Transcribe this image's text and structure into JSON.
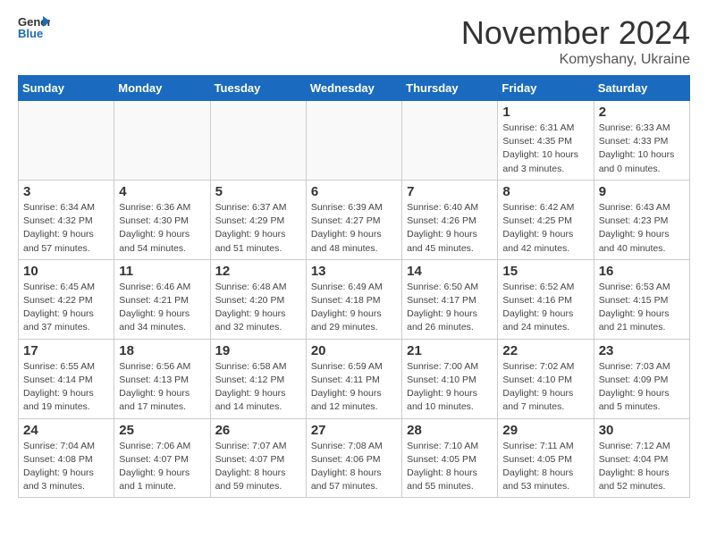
{
  "header": {
    "logo_general": "General",
    "logo_blue": "Blue",
    "month_title": "November 2024",
    "location": "Komyshany, Ukraine"
  },
  "weekdays": [
    "Sunday",
    "Monday",
    "Tuesday",
    "Wednesday",
    "Thursday",
    "Friday",
    "Saturday"
  ],
  "weeks": [
    [
      {
        "day": "",
        "info": ""
      },
      {
        "day": "",
        "info": ""
      },
      {
        "day": "",
        "info": ""
      },
      {
        "day": "",
        "info": ""
      },
      {
        "day": "",
        "info": ""
      },
      {
        "day": "1",
        "info": "Sunrise: 6:31 AM\nSunset: 4:35 PM\nDaylight: 10 hours\nand 3 minutes."
      },
      {
        "day": "2",
        "info": "Sunrise: 6:33 AM\nSunset: 4:33 PM\nDaylight: 10 hours\nand 0 minutes."
      }
    ],
    [
      {
        "day": "3",
        "info": "Sunrise: 6:34 AM\nSunset: 4:32 PM\nDaylight: 9 hours\nand 57 minutes."
      },
      {
        "day": "4",
        "info": "Sunrise: 6:36 AM\nSunset: 4:30 PM\nDaylight: 9 hours\nand 54 minutes."
      },
      {
        "day": "5",
        "info": "Sunrise: 6:37 AM\nSunset: 4:29 PM\nDaylight: 9 hours\nand 51 minutes."
      },
      {
        "day": "6",
        "info": "Sunrise: 6:39 AM\nSunset: 4:27 PM\nDaylight: 9 hours\nand 48 minutes."
      },
      {
        "day": "7",
        "info": "Sunrise: 6:40 AM\nSunset: 4:26 PM\nDaylight: 9 hours\nand 45 minutes."
      },
      {
        "day": "8",
        "info": "Sunrise: 6:42 AM\nSunset: 4:25 PM\nDaylight: 9 hours\nand 42 minutes."
      },
      {
        "day": "9",
        "info": "Sunrise: 6:43 AM\nSunset: 4:23 PM\nDaylight: 9 hours\nand 40 minutes."
      }
    ],
    [
      {
        "day": "10",
        "info": "Sunrise: 6:45 AM\nSunset: 4:22 PM\nDaylight: 9 hours\nand 37 minutes."
      },
      {
        "day": "11",
        "info": "Sunrise: 6:46 AM\nSunset: 4:21 PM\nDaylight: 9 hours\nand 34 minutes."
      },
      {
        "day": "12",
        "info": "Sunrise: 6:48 AM\nSunset: 4:20 PM\nDaylight: 9 hours\nand 32 minutes."
      },
      {
        "day": "13",
        "info": "Sunrise: 6:49 AM\nSunset: 4:18 PM\nDaylight: 9 hours\nand 29 minutes."
      },
      {
        "day": "14",
        "info": "Sunrise: 6:50 AM\nSunset: 4:17 PM\nDaylight: 9 hours\nand 26 minutes."
      },
      {
        "day": "15",
        "info": "Sunrise: 6:52 AM\nSunset: 4:16 PM\nDaylight: 9 hours\nand 24 minutes."
      },
      {
        "day": "16",
        "info": "Sunrise: 6:53 AM\nSunset: 4:15 PM\nDaylight: 9 hours\nand 21 minutes."
      }
    ],
    [
      {
        "day": "17",
        "info": "Sunrise: 6:55 AM\nSunset: 4:14 PM\nDaylight: 9 hours\nand 19 minutes."
      },
      {
        "day": "18",
        "info": "Sunrise: 6:56 AM\nSunset: 4:13 PM\nDaylight: 9 hours\nand 17 minutes."
      },
      {
        "day": "19",
        "info": "Sunrise: 6:58 AM\nSunset: 4:12 PM\nDaylight: 9 hours\nand 14 minutes."
      },
      {
        "day": "20",
        "info": "Sunrise: 6:59 AM\nSunset: 4:11 PM\nDaylight: 9 hours\nand 12 minutes."
      },
      {
        "day": "21",
        "info": "Sunrise: 7:00 AM\nSunset: 4:10 PM\nDaylight: 9 hours\nand 10 minutes."
      },
      {
        "day": "22",
        "info": "Sunrise: 7:02 AM\nSunset: 4:10 PM\nDaylight: 9 hours\nand 7 minutes."
      },
      {
        "day": "23",
        "info": "Sunrise: 7:03 AM\nSunset: 4:09 PM\nDaylight: 9 hours\nand 5 minutes."
      }
    ],
    [
      {
        "day": "24",
        "info": "Sunrise: 7:04 AM\nSunset: 4:08 PM\nDaylight: 9 hours\nand 3 minutes."
      },
      {
        "day": "25",
        "info": "Sunrise: 7:06 AM\nSunset: 4:07 PM\nDaylight: 9 hours\nand 1 minute."
      },
      {
        "day": "26",
        "info": "Sunrise: 7:07 AM\nSunset: 4:07 PM\nDaylight: 8 hours\nand 59 minutes."
      },
      {
        "day": "27",
        "info": "Sunrise: 7:08 AM\nSunset: 4:06 PM\nDaylight: 8 hours\nand 57 minutes."
      },
      {
        "day": "28",
        "info": "Sunrise: 7:10 AM\nSunset: 4:05 PM\nDaylight: 8 hours\nand 55 minutes."
      },
      {
        "day": "29",
        "info": "Sunrise: 7:11 AM\nSunset: 4:05 PM\nDaylight: 8 hours\nand 53 minutes."
      },
      {
        "day": "30",
        "info": "Sunrise: 7:12 AM\nSunset: 4:04 PM\nDaylight: 8 hours\nand 52 minutes."
      }
    ]
  ]
}
